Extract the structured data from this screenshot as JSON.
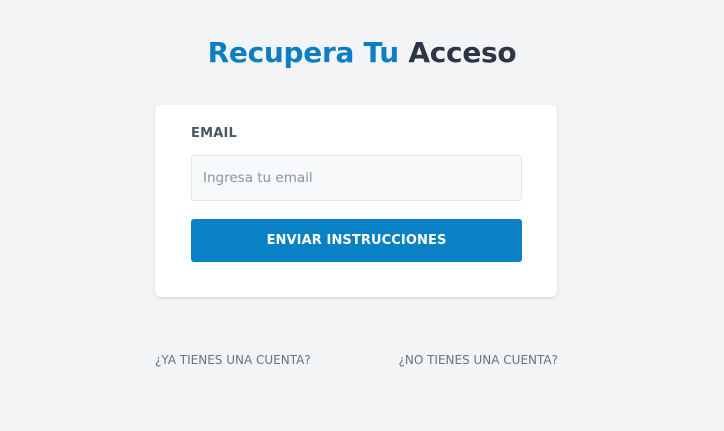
{
  "header": {
    "title_part1": "Recupera Tu",
    "title_part2": "Acceso"
  },
  "form": {
    "email_label": "EMAIL",
    "email_placeholder": "Ingresa tu email",
    "email_value": "",
    "submit_label": "ENVIAR INSTRUCCIONES"
  },
  "footer": {
    "login_link": "¿YA TIENES UNA CUENTA?",
    "register_link": "¿NO TIENES UNA CUENTA?"
  },
  "colors": {
    "brand_blue": "#0c7fc4",
    "title_dark": "#2c3648",
    "button_blue": "#0a80c5",
    "page_background": "#f3f4f6",
    "card_background": "#ffffff"
  }
}
